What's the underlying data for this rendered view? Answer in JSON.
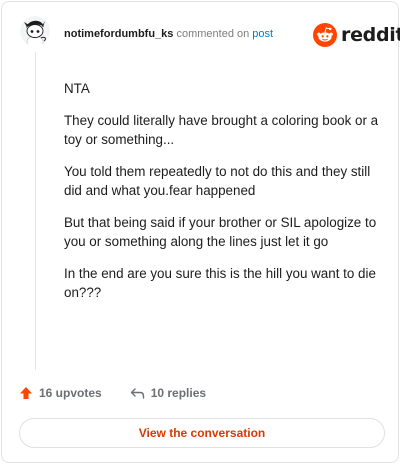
{
  "comment": {
    "username": "notimefordumbfu_ks",
    "action_text": "commented on",
    "post_link_text": "post",
    "body_paragraphs": [
      "NTA",
      "They could literally have brought a coloring book or a toy or something...",
      "You told them repeatedly to not do this and they still did and what you.fear happened",
      "But that being said if your brother or SIL apologize to you or something along the lines just let it go",
      "In the end are you sure this is the hill you want to die on???"
    ],
    "upvotes_label": "16 upvotes",
    "replies_label": "10 replies"
  },
  "brand": {
    "wordmark": "reddit",
    "accent_color": "#ff4500"
  },
  "cta": {
    "label": "View the conversation"
  },
  "icons": {
    "avatar": "snoo-avatar-icon",
    "logo": "reddit-snoo-icon",
    "upvote": "upvote-arrow-icon",
    "reply": "reply-arrow-icon"
  }
}
